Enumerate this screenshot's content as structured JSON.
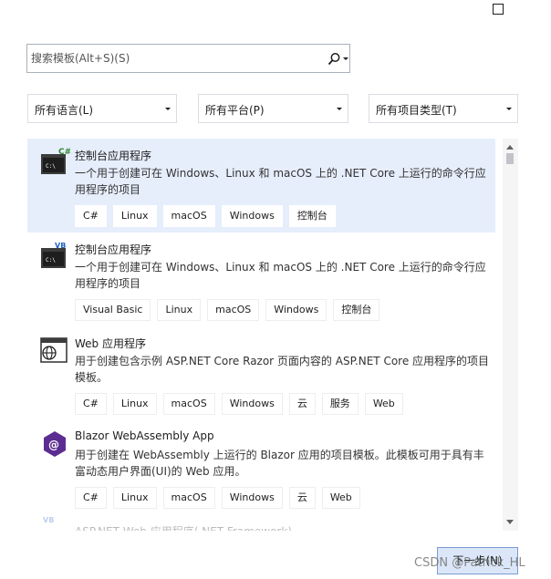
{
  "search": {
    "placeholder": "搜索模板(Alt+S)(S)"
  },
  "filters": {
    "language": "所有语言(L)",
    "platform": "所有平台(P)",
    "project_type": "所有项目类型(T)"
  },
  "templates": [
    {
      "title": "控制台应用程序",
      "icon": "console-csharp-icon",
      "lang_badge": "C#",
      "description": "一个用于创建可在 Windows、Linux 和 macOS 上的 .NET Core 上运行的命令行应用程序的项目",
      "tags": [
        "C#",
        "Linux",
        "macOS",
        "Windows",
        "控制台"
      ]
    },
    {
      "title": "控制台应用程序",
      "icon": "console-vb-icon",
      "lang_badge": "VB",
      "description": "一个用于创建可在 Windows、Linux 和 macOS 上的 .NET Core 上运行的命令行应用程序的项目",
      "tags": [
        "Visual Basic",
        "Linux",
        "macOS",
        "Windows",
        "控制台"
      ]
    },
    {
      "title": "Web 应用程序",
      "icon": "web-app-icon",
      "lang_badge": "",
      "description": "用于创建包含示例 ASP.NET Core Razor 页面内容的 ASP.NET Core 应用程序的项目模板。",
      "tags": [
        "C#",
        "Linux",
        "macOS",
        "Windows",
        "云",
        "服务",
        "Web"
      ]
    },
    {
      "title": "Blazor WebAssembly App",
      "icon": "blazor-icon",
      "lang_badge": "",
      "description": "用于创建在 WebAssembly 上运行的 Blazor 应用的项目模板。此模板可用于具有丰富动态用户界面(UI)的 Web 应用。",
      "tags": [
        "C#",
        "Linux",
        "macOS",
        "Windows",
        "云",
        "Web"
      ]
    }
  ],
  "partial_item": {
    "title": "ASP.NET Web 应用程序(.NET Framework)",
    "lang_badge": "VB"
  },
  "footer": {
    "next_label": "下一步(N)"
  },
  "watermark": "CSDN @Patrick_HL",
  "colors": {
    "selected_bg": "#e6eefc",
    "blazor_purple": "#5c2d91",
    "button_border": "#7a9cd3"
  }
}
